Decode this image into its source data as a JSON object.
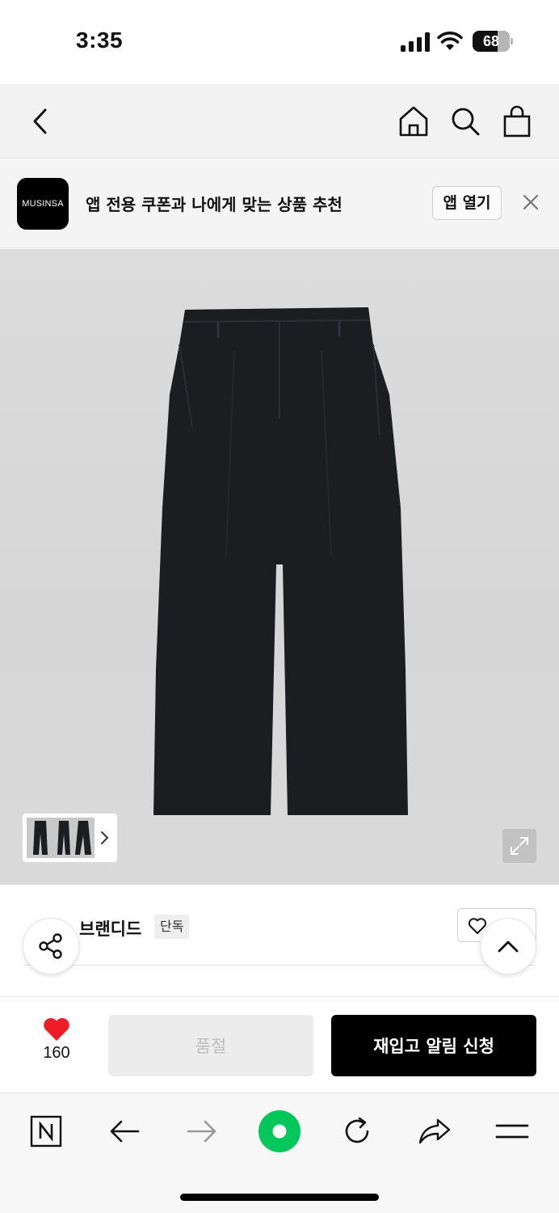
{
  "status_bar": {
    "time": "3:35",
    "battery": "68",
    "battery_fraction": 0.68,
    "icons": [
      "signal-icon",
      "wifi-icon",
      "battery-icon"
    ]
  },
  "browser_header": {
    "icons": [
      "back-chevron-icon",
      "home-icon",
      "search-icon",
      "shopping-bag-icon"
    ]
  },
  "app_banner": {
    "logo_text": "MUSINSA",
    "message": "앱 전용 쿠폰과 나에게 맞는 상품 추천",
    "open_button": "앱 열기",
    "close_icon": "close-icon"
  },
  "product": {
    "image_colors": {
      "background": "#d9d9d9",
      "garment": "#1a1c1e"
    },
    "thumbnail_icon": "chevron-right-icon",
    "expand_icon": "expand-icon"
  },
  "brand": {
    "name": "브랜디드",
    "badge": "단독",
    "like_icon": "heart-outline-icon"
  },
  "purchase": {
    "like_count": "160",
    "like_color": "#ee1c25",
    "soldout_label": "품절",
    "restock_label": "재입고 알림 신청"
  },
  "toolbar": {
    "icons": [
      "naver-n-icon",
      "back-arrow-icon",
      "forward-arrow-icon",
      "green-dot-icon",
      "reload-icon",
      "share-arrow-icon",
      "menu-icon"
    ],
    "accent": "#03c75a"
  }
}
